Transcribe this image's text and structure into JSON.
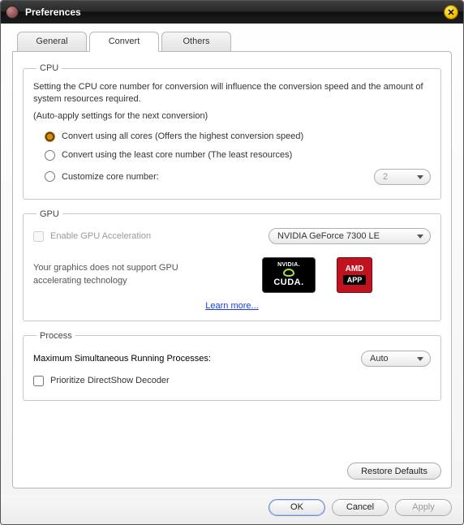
{
  "window": {
    "title": "Preferences"
  },
  "tabs": {
    "general": "General",
    "convert": "Convert",
    "others": "Others",
    "active": "convert"
  },
  "cpu": {
    "legend": "CPU",
    "description": "Setting the CPU core number for conversion will influence the conversion speed and the amount of system resources required.",
    "auto_note": "(Auto-apply settings for the next conversion)",
    "opt_all": "Convert using all cores (Offers the highest conversion speed)",
    "opt_least": "Convert using the least core number (The least resources)",
    "opt_custom": "Customize core number:",
    "custom_value": "2",
    "selected": "all"
  },
  "gpu": {
    "legend": "GPU",
    "enable_label": "Enable GPU Acceleration",
    "enabled": false,
    "device": "NVIDIA GeForce 7300 LE",
    "unsupported_msg": "Your graphics does not support GPU accelerating technology",
    "learn_more": "Learn more...",
    "logo_nvidia_top": "NVIDIA.",
    "logo_nvidia_main": "CUDA.",
    "logo_amd_top": "AMD",
    "logo_amd_main": "APP"
  },
  "process": {
    "legend": "Process",
    "max_label": "Maximum Simultaneous Running Processes:",
    "max_value": "Auto",
    "prioritize_label": "Prioritize DirectShow Decoder",
    "prioritize_checked": false
  },
  "buttons": {
    "restore": "Restore Defaults",
    "ok": "OK",
    "cancel": "Cancel",
    "apply": "Apply"
  }
}
